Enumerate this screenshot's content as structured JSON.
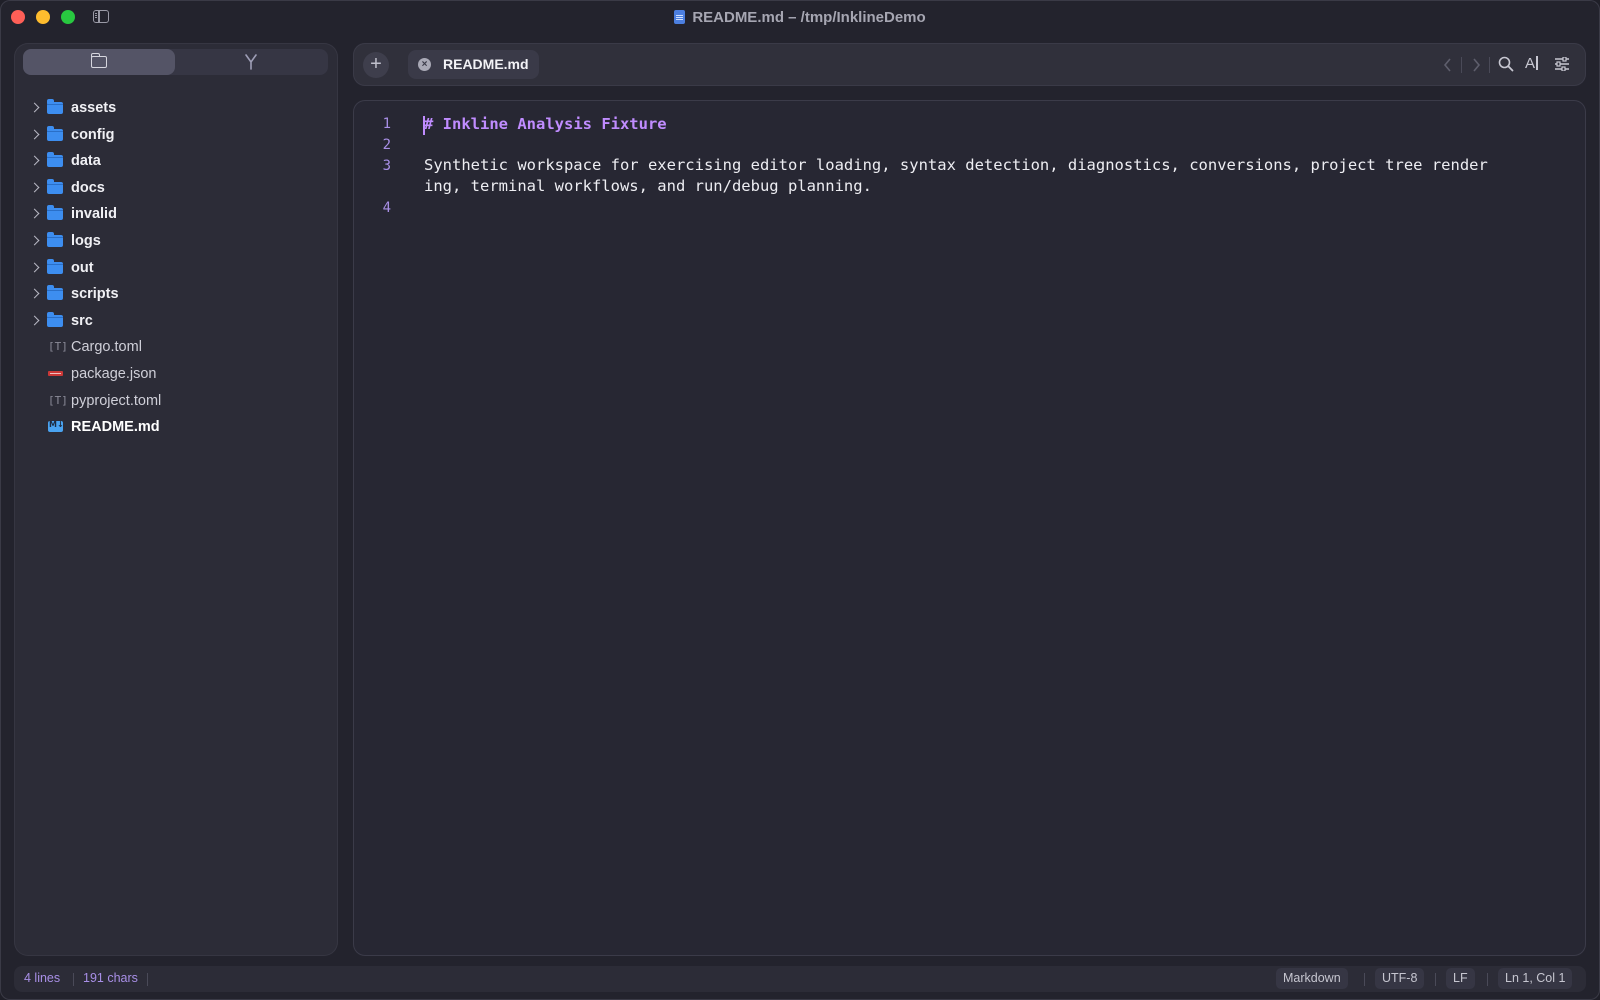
{
  "window": {
    "title": "README.md – /tmp/InklineDemo"
  },
  "sidebar": {
    "tabs": [
      {
        "icon": "folder-icon",
        "active": true
      },
      {
        "icon": "source-control-icon",
        "active": false
      }
    ],
    "tree": [
      {
        "label": "assets",
        "kind": "folder"
      },
      {
        "label": "config",
        "kind": "folder"
      },
      {
        "label": "data",
        "kind": "folder"
      },
      {
        "label": "docs",
        "kind": "folder"
      },
      {
        "label": "invalid",
        "kind": "folder"
      },
      {
        "label": "logs",
        "kind": "folder"
      },
      {
        "label": "out",
        "kind": "folder"
      },
      {
        "label": "scripts",
        "kind": "folder"
      },
      {
        "label": "src",
        "kind": "folder"
      },
      {
        "label": "Cargo.toml",
        "kind": "toml",
        "toml_glyph": "[T]"
      },
      {
        "label": "package.json",
        "kind": "npm"
      },
      {
        "label": "pyproject.toml",
        "kind": "toml",
        "toml_glyph": "[T]"
      },
      {
        "label": "README.md",
        "kind": "markdown",
        "selected": true
      }
    ]
  },
  "tabbar": {
    "add_label": "+",
    "tabs": [
      {
        "label": "README.md",
        "close_glyph": "×",
        "active": true
      }
    ],
    "icons": [
      "chevron-left-icon",
      "chevron-right-icon",
      "search-icon",
      "font-size-icon",
      "settings-sliders-icon"
    ],
    "font_icon_glyph": "A"
  },
  "editor": {
    "line_numbers": [
      "1",
      "2",
      "3",
      "4"
    ],
    "lines": {
      "l1_hash": "#",
      "l1_text": " Inkline Analysis Fixture",
      "l3a": "Synthetic workspace for exercising editor loading, syntax detection, diagnostics, conversions, project tree render",
      "l3b": "ing, terminal workflows, and run/debug planning."
    }
  },
  "status": {
    "lines": "4 lines",
    "chars": "191 chars",
    "language": "Markdown",
    "encoding": "UTF-8",
    "line_ending": "LF",
    "cursor": "Ln 1, Col 1"
  },
  "colors": {
    "heading": "#c08cff",
    "line_number": "#a88fe6",
    "folder": "#3d8ef0"
  }
}
